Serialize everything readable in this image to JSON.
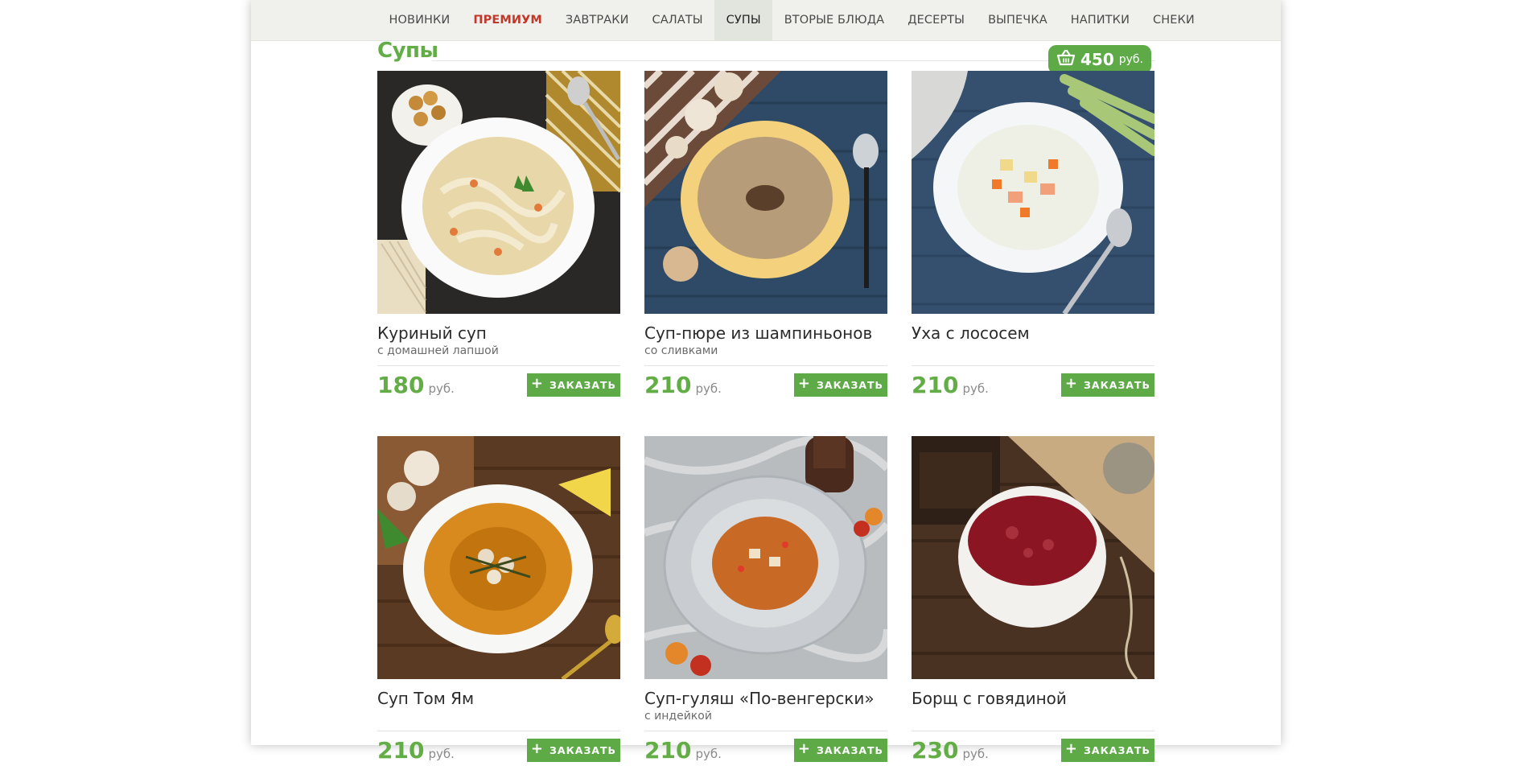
{
  "nav": {
    "items": [
      {
        "label": "НОВИНКИ"
      },
      {
        "label": "ПРЕМИУМ"
      },
      {
        "label": "ЗАВТРАКИ"
      },
      {
        "label": "САЛАТЫ"
      },
      {
        "label": "СУПЫ"
      },
      {
        "label": "ВТОРЫЕ БЛЮДА"
      },
      {
        "label": "ДЕСЕРТЫ"
      },
      {
        "label": "ВЫПЕЧКА"
      },
      {
        "label": "НАПИТКИ"
      },
      {
        "label": "СНЕКИ"
      }
    ],
    "active": "СУПЫ",
    "highlight": "ПРЕМИУМ"
  },
  "section": {
    "title": "Супы"
  },
  "cart": {
    "amount": "450",
    "currency": "руб.",
    "icon": "basket-icon"
  },
  "order_label": "ЗАКАЗАТЬ",
  "currency": "руб.",
  "colors": {
    "accent": "#5daa47",
    "premium": "#c0392b",
    "nav_bg": "#f0f1ed"
  },
  "products": [
    {
      "name": "Куриный суп",
      "sub": "с домашней лапшой",
      "price": "180",
      "image": "chicken-noodle-soup-image"
    },
    {
      "name": "Суп-пюре из шампиньонов",
      "sub": "со сливками",
      "price": "210",
      "image": "mushroom-cream-soup-image"
    },
    {
      "name": "Уха с лососем",
      "sub": "",
      "price": "210",
      "image": "salmon-fish-soup-image"
    },
    {
      "name": "Суп Том Ям",
      "sub": "",
      "price": "210",
      "image": "tom-yum-soup-image"
    },
    {
      "name": "Суп-гуляш «По-венгерски»",
      "sub": "с индейкой",
      "price": "210",
      "image": "goulash-soup-image"
    },
    {
      "name": "Борщ с говядиной",
      "sub": "",
      "price": "230",
      "image": "borscht-image"
    }
  ]
}
